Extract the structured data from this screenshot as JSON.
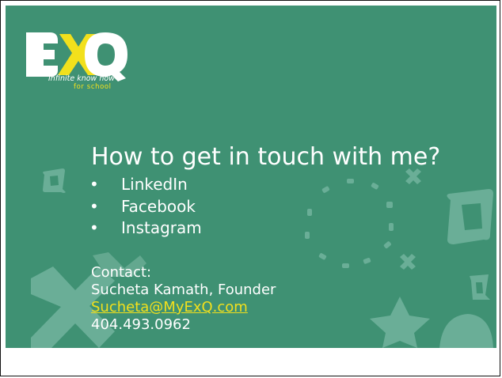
{
  "logo": {
    "text": "ExQ",
    "tagline_line1": "Infinite know how",
    "tagline_line2": "for school",
    "colors": {
      "mark": "#ffffff",
      "accent": "#f2e01c"
    }
  },
  "slide": {
    "title": "How to get in touch with me?",
    "links": [
      {
        "bullet": "•",
        "label": "LinkedIn"
      },
      {
        "bullet": "•",
        "label": "Facebook"
      },
      {
        "bullet": "•",
        "label": "Instagram"
      }
    ],
    "contact": {
      "heading": "Contact:",
      "name": "Sucheta Kamath, Founder",
      "email": "Sucheta@MyExQ.com",
      "phone": "404.493.0962"
    }
  },
  "colors": {
    "background": "#3f9173",
    "decoration": "#6fb19b",
    "accent": "#f2e01c"
  }
}
